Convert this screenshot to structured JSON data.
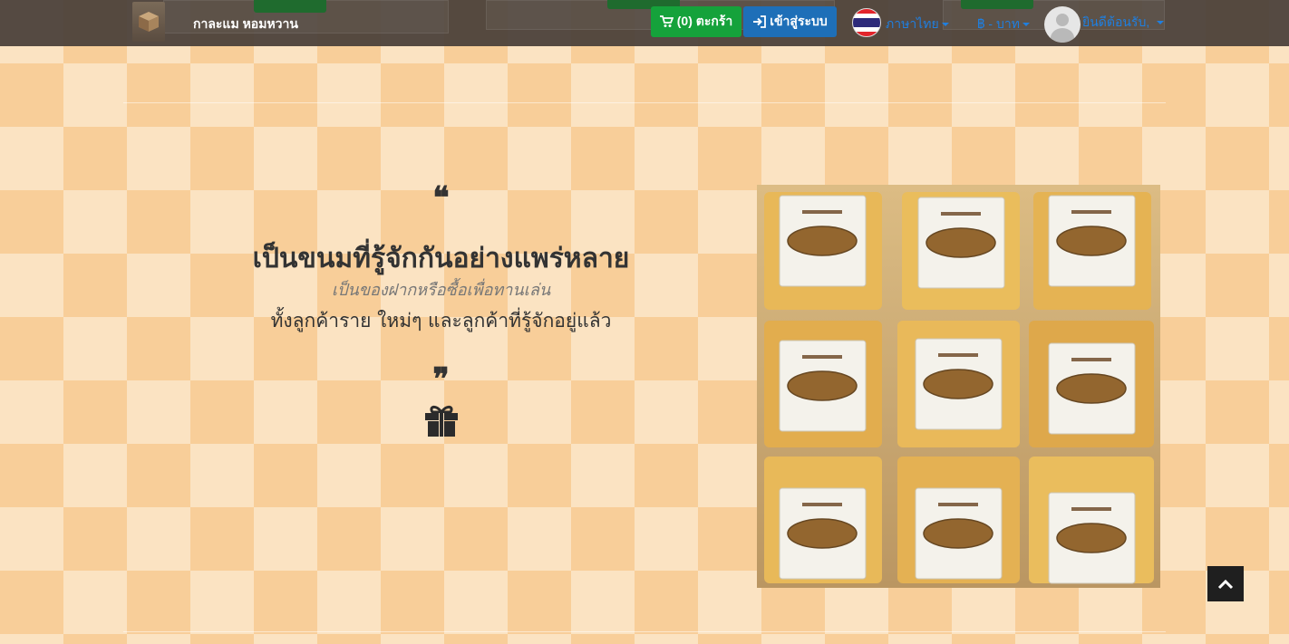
{
  "navbar": {
    "brand": "กาละแม หอมหวาน",
    "cart_label": "(0) ตะกร้า",
    "login_label": "เข้าสู่ระบบ",
    "language_label": "ภาษาไทย",
    "currency_label": "฿ - บาท",
    "welcome_label": "ยินดีต้อนรับ,"
  },
  "hero": {
    "quote_open": "❝",
    "headline": "เป็นขนมที่รู้จักกันอย่างแพร่หลาย",
    "subline": "เป็นของฝากหรือซื้อเพื่อทานเล่น",
    "bodyline": "ทั้งลูกค้าราย ใหม่ๆ และลูกค้าที่รู้จักอยู่แล้ว",
    "quote_close": "❞"
  },
  "colors": {
    "cart_button": "#15a23b",
    "login_button": "#1e6fb8",
    "link": "#1f7fe0",
    "navbar": "#483e38"
  },
  "icons": {
    "cart": "shopping-cart-icon",
    "login": "sign-in-icon",
    "gift": "gift-icon",
    "scroll_top": "chevron-up-icon"
  }
}
